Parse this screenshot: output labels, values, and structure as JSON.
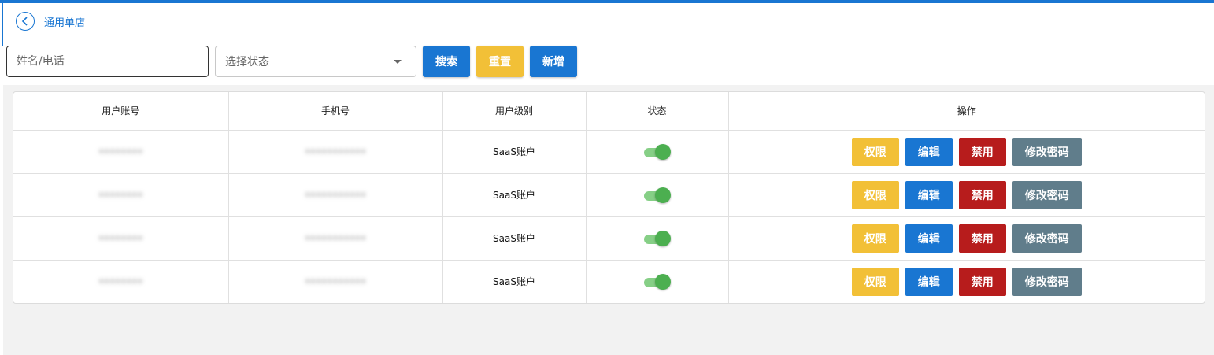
{
  "header": {
    "title": "通用单店"
  },
  "search": {
    "placeholder": "姓名/电话"
  },
  "status_select": {
    "placeholder": "选择状态"
  },
  "toolbar": {
    "search_label": "搜索",
    "reset_label": "重置",
    "add_label": "新增"
  },
  "table": {
    "columns": [
      "用户账号",
      "手机号",
      "用户级别",
      "状态",
      "操作"
    ],
    "rows": [
      {
        "account": "••••••••",
        "phone": "•••••••••••",
        "level": "SaaS账户",
        "status_on": true
      },
      {
        "account": "••••••••",
        "phone": "•••••••••••",
        "level": "SaaS账户",
        "status_on": true
      },
      {
        "account": "••••••••",
        "phone": "•••••••••••",
        "level": "SaaS账户",
        "status_on": true
      },
      {
        "account": "••••••••",
        "phone": "•••••••••••",
        "level": "SaaS账户",
        "status_on": true
      }
    ],
    "actions": {
      "permission": "权限",
      "edit": "编辑",
      "disable": "禁用",
      "change_password": "修改密码"
    }
  },
  "colors": {
    "primary": "#1976d2",
    "warning": "#f2c037",
    "danger": "#b71c1c",
    "secondary": "#607d8b",
    "toggle_on": "#4caf50"
  }
}
